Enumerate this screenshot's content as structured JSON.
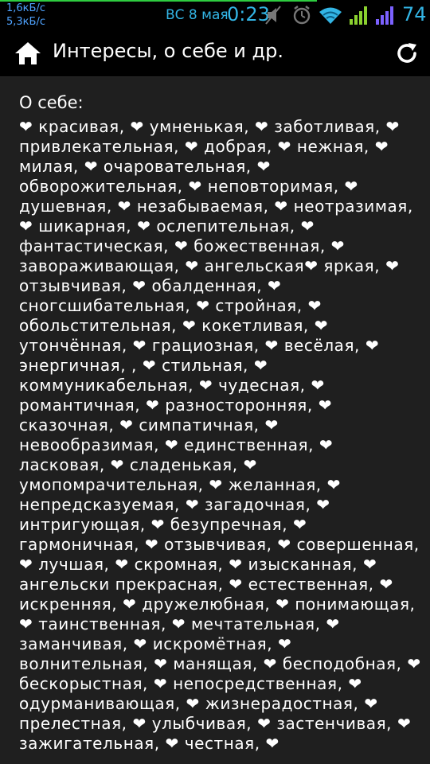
{
  "status": {
    "upload_speed": "1,6кБ/с",
    "download_speed": "5,3кБ/с",
    "date": "ВС 8 мая",
    "time": "0:23",
    "battery": "74"
  },
  "header": {
    "title": "Интересы, о себе и др.",
    "home_icon": "home-icon",
    "refresh_icon": "refresh-icon"
  },
  "section": {
    "title": "О себе:",
    "text": "❤ красивая, ❤ умненькая, ❤ заботливая, ❤ привлекательная, ❤ добрая, ❤ нежная, ❤ милая, ❤ очаровательная, ❤ обворожительная, ❤ неповторимая, ❤ душевная, ❤ незабываемая, ❤ неотразимая, ❤ шикарная, ❤ ослепительная, ❤ фантастическая, ❤ божественная, ❤ завораживающая, ❤ ангельская❤ яркая, ❤ отзывчивая, ❤ обалденная, ❤ сногсшибательная, ❤ стройная, ❤ обольстительная, ❤ кокетливая, ❤ утончённая, ❤ грациозная, ❤ весёлая, ❤ энергичная, , ❤ стильная, ❤ коммуникабельная, ❤ чудесная, ❤ романтичная, ❤ разносторонняя, ❤ сказочная, ❤ симпатичная, ❤ невообразимая, ❤ единственная, ❤ ласковая, ❤ сладенькая, ❤ умопомрачительная, ❤ желанная, ❤ непредсказуемая, ❤ загадочная, ❤ интригующая, ❤ безупречная, ❤ гармоничная, ❤ отзывчивая, ❤ совершенная, ❤ лучшая, ❤ скромная, ❤ изысканная, ❤ ангельски прекрасная, ❤ естественная, ❤ искренняя, ❤ дружелюбная, ❤ понимающая, ❤ таинственная, ❤ мечтательная, ❤ заманчивая, ❤ искромётная, ❤ волнительная, ❤ манящая, ❤ бесподобная, ❤ бескорыстная, ❤ непосредственная, ❤ одурманивающая, ❤ жизнерадостная, ❤ прелестная, ❤ улыбчивая, ❤ застенчивая, ❤ зажигательная, ❤ честная, ❤"
  },
  "colors": {
    "status_blue": "#33b5e5",
    "signal_green": "#8bd12f",
    "signal_purple": "#7b61ff",
    "background": "#1f1f1f"
  }
}
